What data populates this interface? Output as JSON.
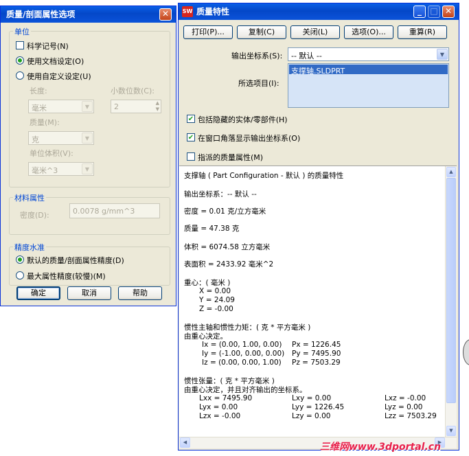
{
  "section_dialog": {
    "title": "质量/剖面属性选项",
    "units_group": "单位",
    "scientific_notation": "科学记号(N)",
    "use_document": "使用文档设定(O)",
    "use_custom": "使用自定义设定(U)",
    "length_label": "长度:",
    "length_value": "毫米",
    "decimals_label": "小数位数(C):",
    "decimals_value": "2",
    "mass_label": "质量(M):",
    "mass_value": "克",
    "volume_label": "单位体积(V):",
    "volume_value": "毫米^3",
    "material_group": "材料属性",
    "density_label": "密度(D):",
    "density_value": "0.0078 g/mm^3",
    "accuracy_group": "精度水准",
    "default_accuracy": "默认的质量/剖面属性精度(D)",
    "max_accuracy": "最大属性精度(较慢)(M)",
    "ok": "确定",
    "cancel": "取消",
    "help": "帮助"
  },
  "mass_window": {
    "title": "质量特性",
    "buttons": [
      "打印(P)...",
      "复制(C)",
      "关闭(L)",
      "选项(O)...",
      "重算(R)"
    ],
    "output_cs_label": "输出坐标系(S):",
    "output_cs_value": "-- 默认 --",
    "selected_items_label": "所选项目(I):",
    "selected_item": "支撑轴.SLDPRT",
    "include_hidden": "包括隐藏的实体/零部件(H)",
    "show_cs_corner": "在窗口角落显示输出坐标系(O)",
    "assigned_mass": "指派的质量属性(M)"
  },
  "results": {
    "header": "支撑轴 ( Part Configuration - 默认 ) 的质量特性",
    "output_cs": "输出坐标系：-- 默认 --",
    "density": "密度 = 0.01 克/立方毫米",
    "mass": "质量 = 47.38 克",
    "volume": "体积 = 6074.58 立方毫米",
    "surface_area": "表面积 = 2433.92 毫米^2",
    "cog_title": "重心：( 毫米 )",
    "cog_x": "X = 0.00",
    "cog_y": "Y = 24.09",
    "cog_z": "Z = -0.00",
    "principal_title": "惯性主轴和惯性力矩：( 克 * 平方毫米 )",
    "principal_sub": "由重心决定。",
    "ix": "Ix = (0.00, 1.00, 0.00)",
    "iy": "Iy = (-1.00, 0.00, 0.00)",
    "iz": "Iz = (0.00, 0.00, 1.00)",
    "px": "Px = 1226.45",
    "py": "Py = 7495.90",
    "pz": "Pz = 7503.29",
    "tensor_title": "惯性张量：( 克 * 平方毫米 )",
    "tensor_sub": "由重心决定，并且对齐输出的坐标系。",
    "lxx": "Lxx = 7495.90",
    "lxy": "Lxy = 0.00",
    "lxz": "Lxz = -0.00",
    "lyx": "Lyx = 0.00",
    "lyy": "Lyy = 1226.45",
    "lyz": "Lyz = 0.00",
    "lzx": "Lzx = -0.00",
    "lzy": "Lzy = 0.00",
    "lzz": "Lzz = 7503.29"
  },
  "watermark": "三维网www.3dportal.cn"
}
